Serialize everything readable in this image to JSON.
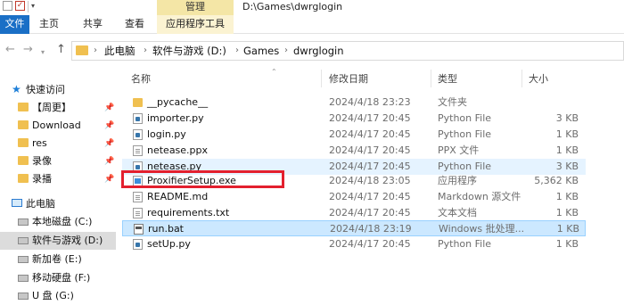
{
  "titlebar": {
    "manage_label": "管理",
    "path_title": "D:\\Games\\dwrglogin"
  },
  "ribbon": {
    "file": "文件",
    "home": "主页",
    "share": "共享",
    "view": "查看",
    "app_tools": "应用程序工具"
  },
  "address": {
    "crumbs": [
      "此电脑",
      "软件与游戏 (D:)",
      "Games",
      "dwrglogin"
    ]
  },
  "navpane": {
    "quick_access": "快速访问",
    "quick_items": [
      "【周更】",
      "Download",
      "res",
      "录像",
      "录播"
    ],
    "this_pc": "此电脑",
    "drives": [
      "本地磁盘 (C:)",
      "软件与游戏 (D:)",
      "新加卷 (E:)",
      "移动硬盘 (F:)",
      "U 盘 (G:)"
    ]
  },
  "columns": {
    "name": "名称",
    "date": "修改日期",
    "type": "类型",
    "size": "大小"
  },
  "files": [
    {
      "name": "__pycache__",
      "date": "2024/4/18 23:23",
      "type": "文件夹",
      "size": "",
      "icon": "folder-icon"
    },
    {
      "name": "importer.py",
      "date": "2024/4/17 20:45",
      "type": "Python File",
      "size": "3 KB",
      "icon": "python-file-icon"
    },
    {
      "name": "login.py",
      "date": "2024/4/17 20:45",
      "type": "Python File",
      "size": "1 KB",
      "icon": "python-file-icon"
    },
    {
      "name": "netease.ppx",
      "date": "2024/4/17 20:45",
      "type": "PPX 文件",
      "size": "1 KB",
      "icon": "document-icon"
    },
    {
      "name": "netease.py",
      "date": "2024/4/17 20:45",
      "type": "Python File",
      "size": "3 KB",
      "icon": "python-file-icon"
    },
    {
      "name": "ProxifierSetup.exe",
      "date": "2024/4/18 23:05",
      "type": "应用程序",
      "size": "5,362 KB",
      "icon": "exe-icon"
    },
    {
      "name": "README.md",
      "date": "2024/4/17 20:45",
      "type": "Markdown 源文件",
      "size": "1 KB",
      "icon": "document-icon"
    },
    {
      "name": "requirements.txt",
      "date": "2024/4/17 20:45",
      "type": "文本文档",
      "size": "1 KB",
      "icon": "document-icon"
    },
    {
      "name": "run.bat",
      "date": "2024/4/18 23:19",
      "type": "Windows 批处理...",
      "size": "1 KB",
      "icon": "batch-file-icon"
    },
    {
      "name": "setUp.py",
      "date": "2024/4/17 20:45",
      "type": "Python File",
      "size": "1 KB",
      "icon": "python-file-icon"
    }
  ],
  "colors": {
    "accent": "#1a6fc6",
    "selection": "#cce8ff",
    "highlight": "#e3202e",
    "manage_tab": "#f4e6a6"
  }
}
